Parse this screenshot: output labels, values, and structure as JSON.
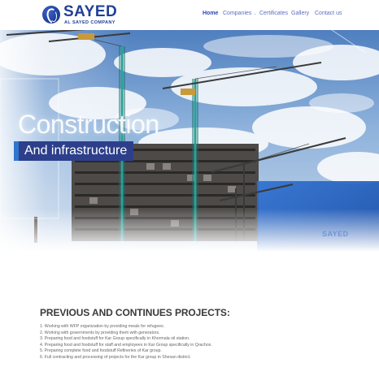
{
  "header": {
    "logo": {
      "name": "SAYED",
      "subtitle": "AL SAYED COMPANY"
    },
    "nav": [
      {
        "label": "Home",
        "active": true
      },
      {
        "label": "Companies",
        "has_dropdown": true
      },
      {
        "label": "Certificates"
      },
      {
        "label": "Gallery"
      },
      {
        "label": "Contact us"
      }
    ]
  },
  "hero": {
    "title": "Construction",
    "subtitle": "And infrastructure",
    "watermark": "SAYED"
  },
  "projects": {
    "title": "PREVIOUS AND CONTINUES PROJECTS:",
    "items": [
      "1. Working with WFP organization by providing meals for refugees.",
      "2. Working with governments by providing them with generators.",
      "3. Preparing food and foodstuff for Kar Group specifically in Khormala oil station.",
      "4. Preparing food and foodstuff for staff and employees in Kar Group specifically in Qrachox.",
      "5. Preparing complete food and foodstuff Refineries of Kar group.",
      "6. Full contracting and processing of projects for the Kar group in Shexan district."
    ]
  },
  "colors": {
    "brand": "#203f96",
    "nav_link": "#5a6ec2",
    "subtitle_bar": "#2d3f8b",
    "accent_blue": "#2f76cf"
  }
}
